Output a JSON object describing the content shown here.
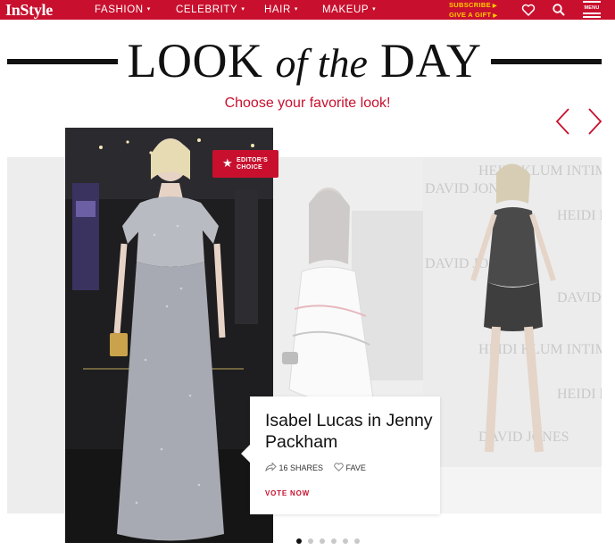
{
  "nav": {
    "logo": "InStyle",
    "items": [
      {
        "label": "FASHION",
        "caret": "▾"
      },
      {
        "label": "CELEBRITY",
        "caret": "▾"
      },
      {
        "label": "HAIR",
        "caret": "▾"
      },
      {
        "label": "MAKEUP",
        "caret": "▾"
      }
    ],
    "promo": {
      "subscribe": "SUBSCRIBE",
      "gift": "GIVE A GIFT",
      "arrow": "▶"
    },
    "icons": [
      "heart-icon",
      "search-icon",
      "menu-icon"
    ],
    "menu_label": "MENU"
  },
  "heading": {
    "look": "LOOK",
    "of_the": "of the",
    "day": "DAY"
  },
  "subheading": "Choose your favorite look!",
  "carousel": {
    "featured": {
      "badge": {
        "line1": "EDITOR'S",
        "line2": "CHOICE",
        "star": "★"
      },
      "title": "Isabel Lucas in Jenny Packham",
      "shares_count": "16",
      "shares_label": "SHARES",
      "fave_label": "FAVE",
      "vote_label": "VOTE NOW"
    },
    "backdrop_text": [
      "DAVID JONES",
      "HEIDI KLUM INTIMATES"
    ],
    "dots_total": 6,
    "dots_active": 1
  },
  "colors": {
    "brand_red": "#c8102e",
    "promo_yellow": "#ffcc00",
    "heading_black": "#111111"
  }
}
